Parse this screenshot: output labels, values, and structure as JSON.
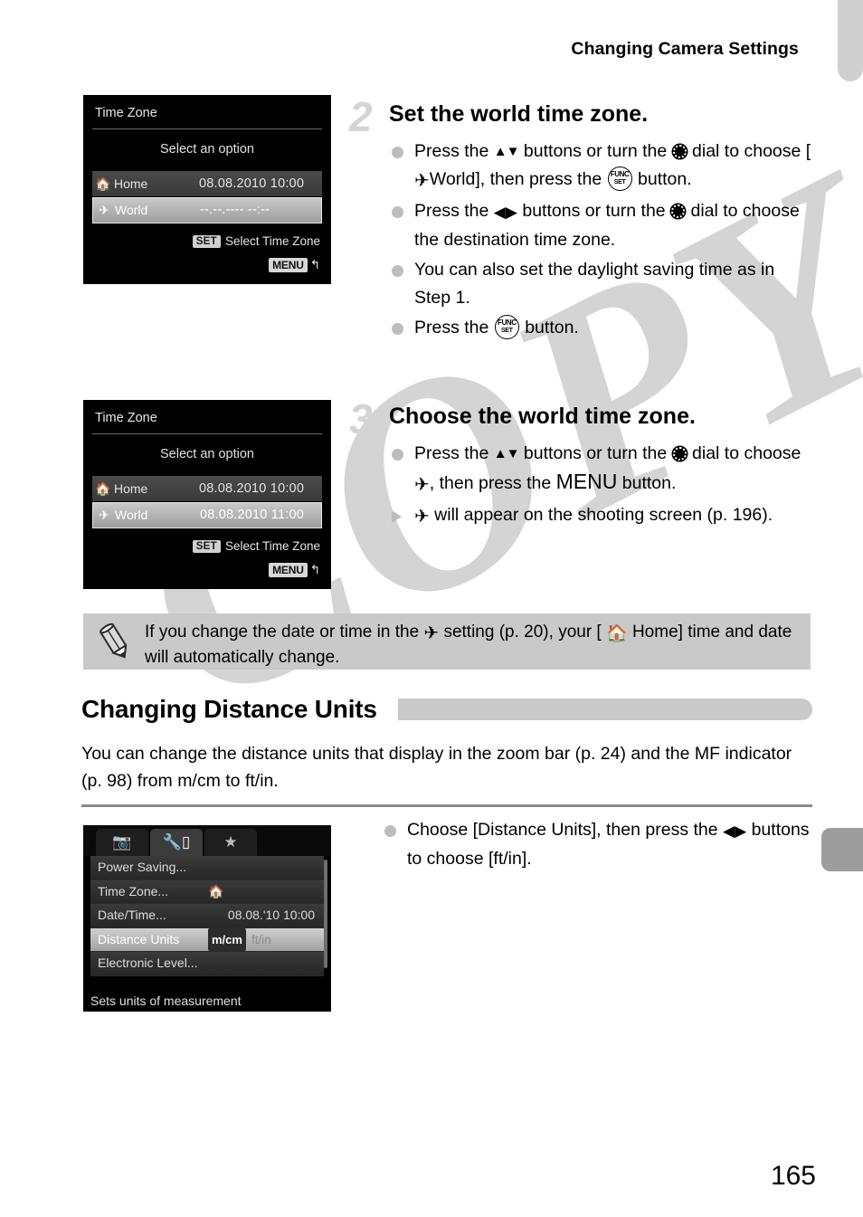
{
  "header": {
    "title": "Changing Camera Settings"
  },
  "watermark": {
    "text": "COPY"
  },
  "screens": {
    "time_zone_world_blank": {
      "title": "Time Zone",
      "subtitle": "Select an option",
      "rows": [
        {
          "icon": "home-icon",
          "label": "Home",
          "value": "08.08.2010 10:00",
          "selected": false
        },
        {
          "icon": "airplane-icon",
          "label": "World",
          "value": "--.--.---- --:--",
          "selected": true
        }
      ],
      "set_badge": "SET",
      "set_hint": "Select Time Zone",
      "menu_badge": "MENU",
      "menu_hint": "↰"
    },
    "time_zone_world_set": {
      "title": "Time Zone",
      "subtitle": "Select an option",
      "rows": [
        {
          "icon": "home-icon",
          "label": "Home",
          "value": "08.08.2010 10:00",
          "selected": false
        },
        {
          "icon": "airplane-icon",
          "label": "World",
          "value": "08.08.2010 11:00",
          "selected": true
        }
      ],
      "set_badge": "SET",
      "set_hint": "Select Time Zone",
      "menu_badge": "MENU",
      "menu_hint": "↰"
    },
    "settings_menu": {
      "tabs": [
        {
          "name": "shooting-tab",
          "icon": "camera-icon",
          "active": false
        },
        {
          "name": "settings-tab",
          "icon": "wrench-tool-icon",
          "active": true
        },
        {
          "name": "my-menu-tab",
          "icon": "star-icon",
          "active": false
        }
      ],
      "items": [
        {
          "label": "Power Saving...",
          "value": "",
          "selected": false
        },
        {
          "label": "Time Zone...",
          "value": "home-icon",
          "selected": false
        },
        {
          "label": "Date/Time...",
          "value": "08.08.'10 10:00",
          "selected": false
        },
        {
          "label": "Distance Units",
          "value": "",
          "selected": true,
          "unit_on": "m/cm",
          "unit_off": "ft/in"
        },
        {
          "label": "Electronic Level...",
          "value": "",
          "selected": false
        }
      ],
      "footer": "Sets units of measurement"
    }
  },
  "steps": [
    {
      "number": "2",
      "title": "Set the world time zone.",
      "bullets": [
        {
          "marker": "dot",
          "parts": [
            "Press the ",
            "arrows-updown",
            " buttons or turn the ",
            "dial",
            " dial to choose [",
            "airplane",
            "World], then press the ",
            "funcset",
            " button."
          ]
        },
        {
          "marker": "dot",
          "parts": [
            "Press the ",
            "arrows-leftright",
            " buttons or turn the ",
            "dial",
            " dial to choose the destination time zone."
          ]
        },
        {
          "marker": "dot",
          "parts": [
            "You can also set the daylight saving time as in Step 1."
          ]
        },
        {
          "marker": "dot",
          "parts": [
            "Press the ",
            "funcset",
            " button."
          ]
        }
      ]
    },
    {
      "number": "3",
      "title": "Choose the world time zone.",
      "bullets": [
        {
          "marker": "dot",
          "parts": [
            "Press the ",
            "arrows-updown",
            " buttons or turn the ",
            "dial",
            " dial to choose ",
            "airplane",
            ", then press the ",
            "MENU",
            " button."
          ]
        },
        {
          "marker": "triangle",
          "parts": [
            "airplane",
            " will appear on the shooting screen (p. 196)."
          ]
        }
      ]
    }
  ],
  "step2": {
    "b1_a": "Press the ",
    "b1_b": " buttons or turn the ",
    "b1_c": " dial to choose [",
    "b1_d": "World], then press the ",
    "b1_e": " button.",
    "b2_a": "Press the ",
    "b2_b": " buttons or turn the ",
    "b2_c": " dial to choose the destination time zone.",
    "b3": "You can also set the daylight saving time as in Step 1.",
    "b4_a": "Press the ",
    "b4_b": " button."
  },
  "step3": {
    "b1_a": "Press the ",
    "b1_b": " buttons or turn the ",
    "b1_c": " dial to choose ",
    "b1_d": ", then press the ",
    "b1_e": "MENU",
    "b1_f": " button.",
    "b2_a": " will appear on the shooting screen (p. 196)."
  },
  "note": {
    "icon": "pencil-icon",
    "text_a": "If you change the date or time in the ",
    "text_b": " setting (p. 20), your [ ",
    "text_c": " Home] time and date will automatically change."
  },
  "section": {
    "heading": "Changing Distance Units",
    "body": "You can change the distance units that display in the zoom bar (p. 24) and the MF indicator (p. 98) from m/cm to ft/in."
  },
  "bottom_instruction": {
    "text_a": "Choose [Distance Units], then press the ",
    "text_b": " buttons to choose [ft/in]."
  },
  "page_number": "165",
  "colors": {
    "note_bg": "#c9c9c9",
    "heading_bar": "#c9c9c9",
    "step_number": "#d4d4d4",
    "bullet_dot": "#bdbdbd",
    "watermark": "#d2d2d2",
    "rule": "#8b8b8b"
  }
}
